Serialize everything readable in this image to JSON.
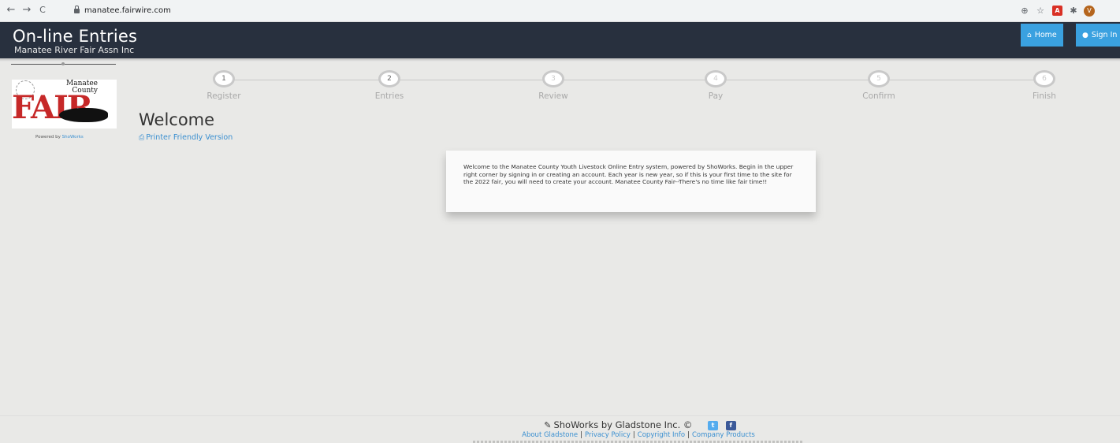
{
  "browser": {
    "back_icon": "←",
    "forward_icon": "→",
    "reload_icon": "C",
    "url": "manatee.fairwire.com",
    "zoom_icon": "⊕",
    "star_icon": "☆",
    "ext_icon": "✱",
    "pdf_label": "A",
    "avatar_letter": "V"
  },
  "header": {
    "title": "On-line Entries",
    "subtitle": "Manatee River Fair Assn Inc",
    "home_label": "Home",
    "signin_label": "Sign In"
  },
  "logo": {
    "county_line1": "Manatee",
    "county_line2": "County",
    "fair_text": "FAIR",
    "powered_prefix": "Powered by",
    "powered_brand": "ShoWorks"
  },
  "steps": [
    {
      "number": "1",
      "label": "Register"
    },
    {
      "number": "2",
      "label": "Entries"
    },
    {
      "number": "3",
      "label": "Review"
    },
    {
      "number": "4",
      "label": "Pay"
    },
    {
      "number": "5",
      "label": "Confirm"
    },
    {
      "number": "6",
      "label": "Finish"
    }
  ],
  "main": {
    "title": "Welcome",
    "printer_link": "Printer Friendly Version",
    "welcome_text": "Welcome to the Manatee County Youth Livestock Online Entry system, powered by ShoWorks.  Begin in the upper right corner by signing in or creating an account.  Each year is new year, so if this is your first time to the site for the 2022 fair, you will need to create your account.  Manatee County Fair--There's no time like fair time!!"
  },
  "footer": {
    "brand": "ShoWorks by Gladstone Inc. ©",
    "twitter_glyph": "t",
    "facebook_glyph": "f",
    "links": [
      "About Gladstone",
      "Privacy Policy",
      "Copyright Info",
      "Company Products"
    ]
  }
}
